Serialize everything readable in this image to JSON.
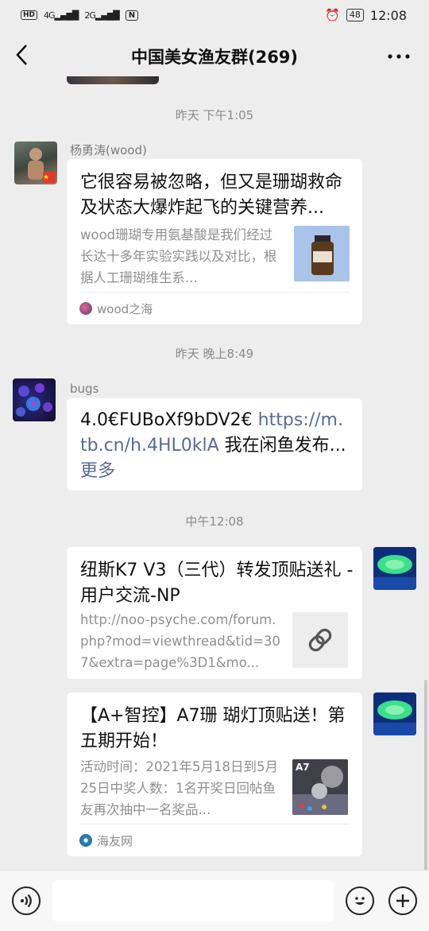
{
  "status_bar": {
    "hd": "HD",
    "signal1": "4G",
    "signal2": "2G",
    "nfc": "N",
    "battery": "48",
    "time": "12:08"
  },
  "header": {
    "title": "中国美女渔友群(269)"
  },
  "messages": {
    "ts1": "昨天 下午1:05",
    "ts2": "昨天 晚上8:49",
    "ts3": "中午12:08",
    "m1": {
      "sender": "杨勇涛(wood)",
      "title": "它很容易被忽略，但又是珊瑚救命及状态大爆炸起飞的关键营养...",
      "desc": "wood珊瑚专用氨基酸是我们经过长达十多年实验实践以及对比，根据人工珊瑚维生系...",
      "source": "wood之海"
    },
    "m2": {
      "sender": "bugs",
      "text_plain": "4.0€FUBoXf9bDV2€ ",
      "text_link": "https://m.tb.cn/h.4HL0klA",
      "text_after": " 我在闲鱼发布...",
      "text_more": "更多"
    },
    "m3": {
      "title": "纽斯K7 V3（三代）转发顶贴送礼 - 用户交流-NP",
      "desc": "http://noo-psyche.com/forum.php?mod=viewthread&tid=307&extra=page%3D1&mo..."
    },
    "m4": {
      "title": "【A+智控】A7珊 瑚灯顶贴送！第五期开始！",
      "desc": "活动时间：2021年5月18日到5月25日中奖人数：1名开奖日回帖鱼友再次抽中一名奖品...",
      "thumb_label": "A7",
      "source": "海友网"
    }
  },
  "icons": {
    "back": "chevron-left-icon",
    "more": "more-dots-icon",
    "voice": "voice-icon",
    "emoji": "emoji-icon",
    "plus": "plus-icon",
    "link": "link-icon"
  },
  "colors": {
    "background": "#ededed",
    "bubble": "#ffffff",
    "link": "#576b95"
  }
}
